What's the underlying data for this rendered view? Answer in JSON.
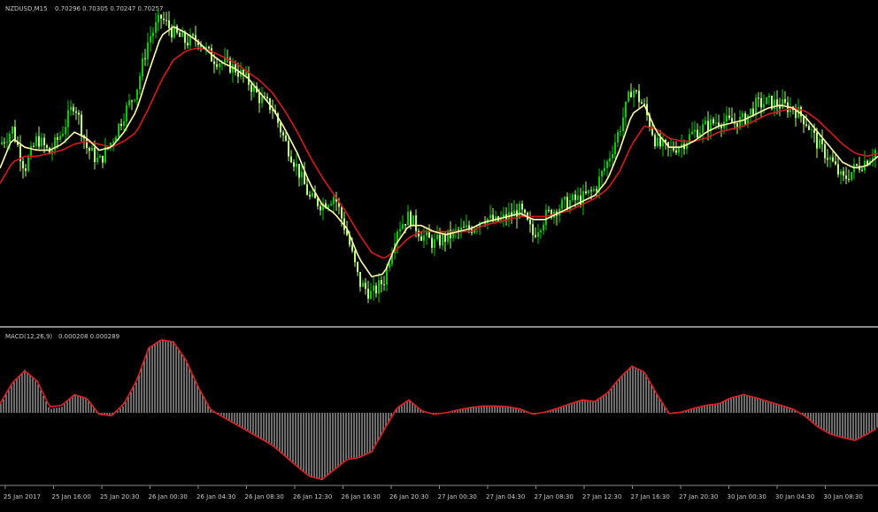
{
  "chart_data": [
    {
      "type": "candlestick",
      "title": "NZDUSD,M15",
      "readout": "0.70296 0.70305 0.70247 0.70257",
      "ylim": [
        0.0,
        1.0
      ],
      "colors": {
        "bull": "#00d000",
        "bear": "#b6ff7a",
        "ma_fast": "#ffffaa",
        "ma_slow": "#d81a1a",
        "background": "#000000"
      },
      "x": [
        0,
        14,
        28,
        42,
        56,
        70,
        84,
        98,
        112,
        126,
        140,
        154,
        168,
        182,
        196,
        210,
        224,
        238,
        252,
        266,
        280,
        294,
        308,
        322,
        336,
        350,
        364,
        378,
        392,
        406,
        420,
        434,
        448,
        462,
        476,
        490,
        504,
        518,
        532,
        546,
        560,
        574,
        588,
        602,
        616,
        630,
        644,
        658,
        672,
        686,
        700,
        714,
        728,
        742,
        756,
        770,
        784,
        798,
        812,
        826,
        840,
        854,
        868,
        882,
        896,
        910,
        924,
        938,
        952,
        966,
        980,
        992
      ],
      "close": [
        0.58,
        0.63,
        0.5,
        0.6,
        0.55,
        0.62,
        0.72,
        0.57,
        0.52,
        0.59,
        0.68,
        0.76,
        0.93,
        1.0,
        0.95,
        0.92,
        0.93,
        0.87,
        0.85,
        0.83,
        0.79,
        0.73,
        0.7,
        0.59,
        0.5,
        0.4,
        0.38,
        0.41,
        0.28,
        0.12,
        0.08,
        0.13,
        0.3,
        0.34,
        0.28,
        0.25,
        0.27,
        0.29,
        0.3,
        0.34,
        0.32,
        0.34,
        0.36,
        0.28,
        0.34,
        0.37,
        0.39,
        0.4,
        0.43,
        0.52,
        0.63,
        0.77,
        0.7,
        0.58,
        0.56,
        0.58,
        0.62,
        0.64,
        0.66,
        0.65,
        0.66,
        0.71,
        0.72,
        0.71,
        0.7,
        0.66,
        0.58,
        0.53,
        0.46,
        0.5,
        0.53,
        0.57
      ],
      "ma_fast": [
        0.5,
        0.6,
        0.57,
        0.56,
        0.56,
        0.58,
        0.62,
        0.6,
        0.56,
        0.57,
        0.62,
        0.69,
        0.82,
        0.94,
        0.97,
        0.95,
        0.92,
        0.88,
        0.85,
        0.83,
        0.8,
        0.75,
        0.7,
        0.63,
        0.55,
        0.45,
        0.38,
        0.35,
        0.3,
        0.2,
        0.14,
        0.15,
        0.25,
        0.31,
        0.31,
        0.29,
        0.28,
        0.29,
        0.3,
        0.32,
        0.33,
        0.34,
        0.35,
        0.33,
        0.33,
        0.35,
        0.37,
        0.39,
        0.41,
        0.46,
        0.56,
        0.68,
        0.71,
        0.62,
        0.57,
        0.57,
        0.59,
        0.62,
        0.64,
        0.65,
        0.66,
        0.68,
        0.7,
        0.71,
        0.7,
        0.67,
        0.62,
        0.57,
        0.52,
        0.5,
        0.51,
        0.54
      ],
      "ma_slow": [
        0.45,
        0.52,
        0.54,
        0.54,
        0.55,
        0.56,
        0.58,
        0.59,
        0.58,
        0.57,
        0.59,
        0.62,
        0.7,
        0.79,
        0.86,
        0.89,
        0.9,
        0.89,
        0.87,
        0.85,
        0.82,
        0.79,
        0.75,
        0.69,
        0.62,
        0.54,
        0.47,
        0.41,
        0.35,
        0.28,
        0.22,
        0.2,
        0.23,
        0.27,
        0.29,
        0.29,
        0.29,
        0.29,
        0.29,
        0.31,
        0.32,
        0.33,
        0.34,
        0.34,
        0.34,
        0.35,
        0.36,
        0.38,
        0.4,
        0.43,
        0.49,
        0.58,
        0.64,
        0.63,
        0.6,
        0.59,
        0.59,
        0.6,
        0.62,
        0.63,
        0.64,
        0.66,
        0.68,
        0.69,
        0.7,
        0.69,
        0.66,
        0.62,
        0.58,
        0.55,
        0.54,
        0.55
      ]
    },
    {
      "type": "histogram",
      "title": "MACD(12,26,9)",
      "readout": "0.000208 0.000289",
      "ylim": [
        -1.0,
        1.0
      ],
      "colors": {
        "bars": "#9a9a9a",
        "signal": "#e02020"
      },
      "x": [
        0,
        14,
        28,
        42,
        56,
        70,
        84,
        98,
        112,
        126,
        140,
        154,
        168,
        182,
        196,
        210,
        224,
        238,
        252,
        266,
        280,
        294,
        308,
        322,
        336,
        350,
        364,
        378,
        392,
        406,
        420,
        434,
        448,
        462,
        476,
        490,
        504,
        518,
        532,
        546,
        560,
        574,
        588,
        602,
        616,
        630,
        644,
        658,
        672,
        686,
        700,
        714,
        728,
        742,
        756,
        770,
        784,
        798,
        812,
        826,
        840,
        854,
        868,
        882,
        896,
        910,
        924,
        938,
        952,
        966,
        980,
        992
      ],
      "macd": [
        0.1,
        0.38,
        0.57,
        0.4,
        0.05,
        0.08,
        0.25,
        0.2,
        -0.03,
        -0.05,
        0.1,
        0.4,
        0.85,
        0.97,
        0.95,
        0.7,
        0.35,
        0.05,
        -0.05,
        -0.15,
        -0.25,
        -0.35,
        -0.45,
        -0.6,
        -0.75,
        -0.9,
        -0.95,
        -0.8,
        -0.65,
        -0.62,
        -0.55,
        -0.25,
        0.05,
        0.18,
        0.03,
        -0.03,
        0.0,
        0.04,
        0.08,
        0.1,
        0.1,
        0.08,
        0.05,
        -0.02,
        0.0,
        0.06,
        0.12,
        0.18,
        0.15,
        0.25,
        0.45,
        0.62,
        0.55,
        0.25,
        -0.02,
        0.0,
        0.06,
        0.1,
        0.12,
        0.2,
        0.25,
        0.2,
        0.15,
        0.1,
        0.05,
        -0.05,
        -0.2,
        -0.3,
        -0.35,
        -0.4,
        -0.3,
        -0.2
      ],
      "signal": [
        0.12,
        0.4,
        0.56,
        0.42,
        0.08,
        0.1,
        0.24,
        0.19,
        -0.02,
        -0.04,
        0.12,
        0.42,
        0.86,
        0.97,
        0.94,
        0.7,
        0.34,
        0.04,
        -0.06,
        -0.16,
        -0.26,
        -0.36,
        -0.46,
        -0.61,
        -0.76,
        -0.9,
        -0.94,
        -0.8,
        -0.66,
        -0.63,
        -0.55,
        -0.24,
        0.06,
        0.17,
        0.03,
        -0.02,
        0.0,
        0.04,
        0.07,
        0.09,
        0.09,
        0.08,
        0.05,
        -0.02,
        0.01,
        0.06,
        0.12,
        0.17,
        0.15,
        0.26,
        0.46,
        0.62,
        0.54,
        0.25,
        -0.01,
        0.01,
        0.06,
        0.1,
        0.12,
        0.2,
        0.24,
        0.2,
        0.15,
        0.1,
        0.05,
        -0.05,
        -0.2,
        -0.3,
        -0.35,
        -0.39,
        -0.3,
        -0.21
      ]
    }
  ],
  "x_axis": {
    "ticks": [
      "25 Jan 2017",
      "25 Jan 16:00",
      "25 Jan 20:30",
      "26 Jan 00:30",
      "26 Jan 04:30",
      "26 Jan 08:30",
      "26 Jan 12:30",
      "26 Jan 16:30",
      "26 Jan 20:30",
      "27 Jan 00:30",
      "27 Jan 04:30",
      "27 Jan 08:30",
      "27 Jan 12:30",
      "27 Jan 16:30",
      "27 Jan 20:30",
      "30 Jan 00:30",
      "30 Jan 04:30",
      "30 Jan 08:30"
    ]
  }
}
